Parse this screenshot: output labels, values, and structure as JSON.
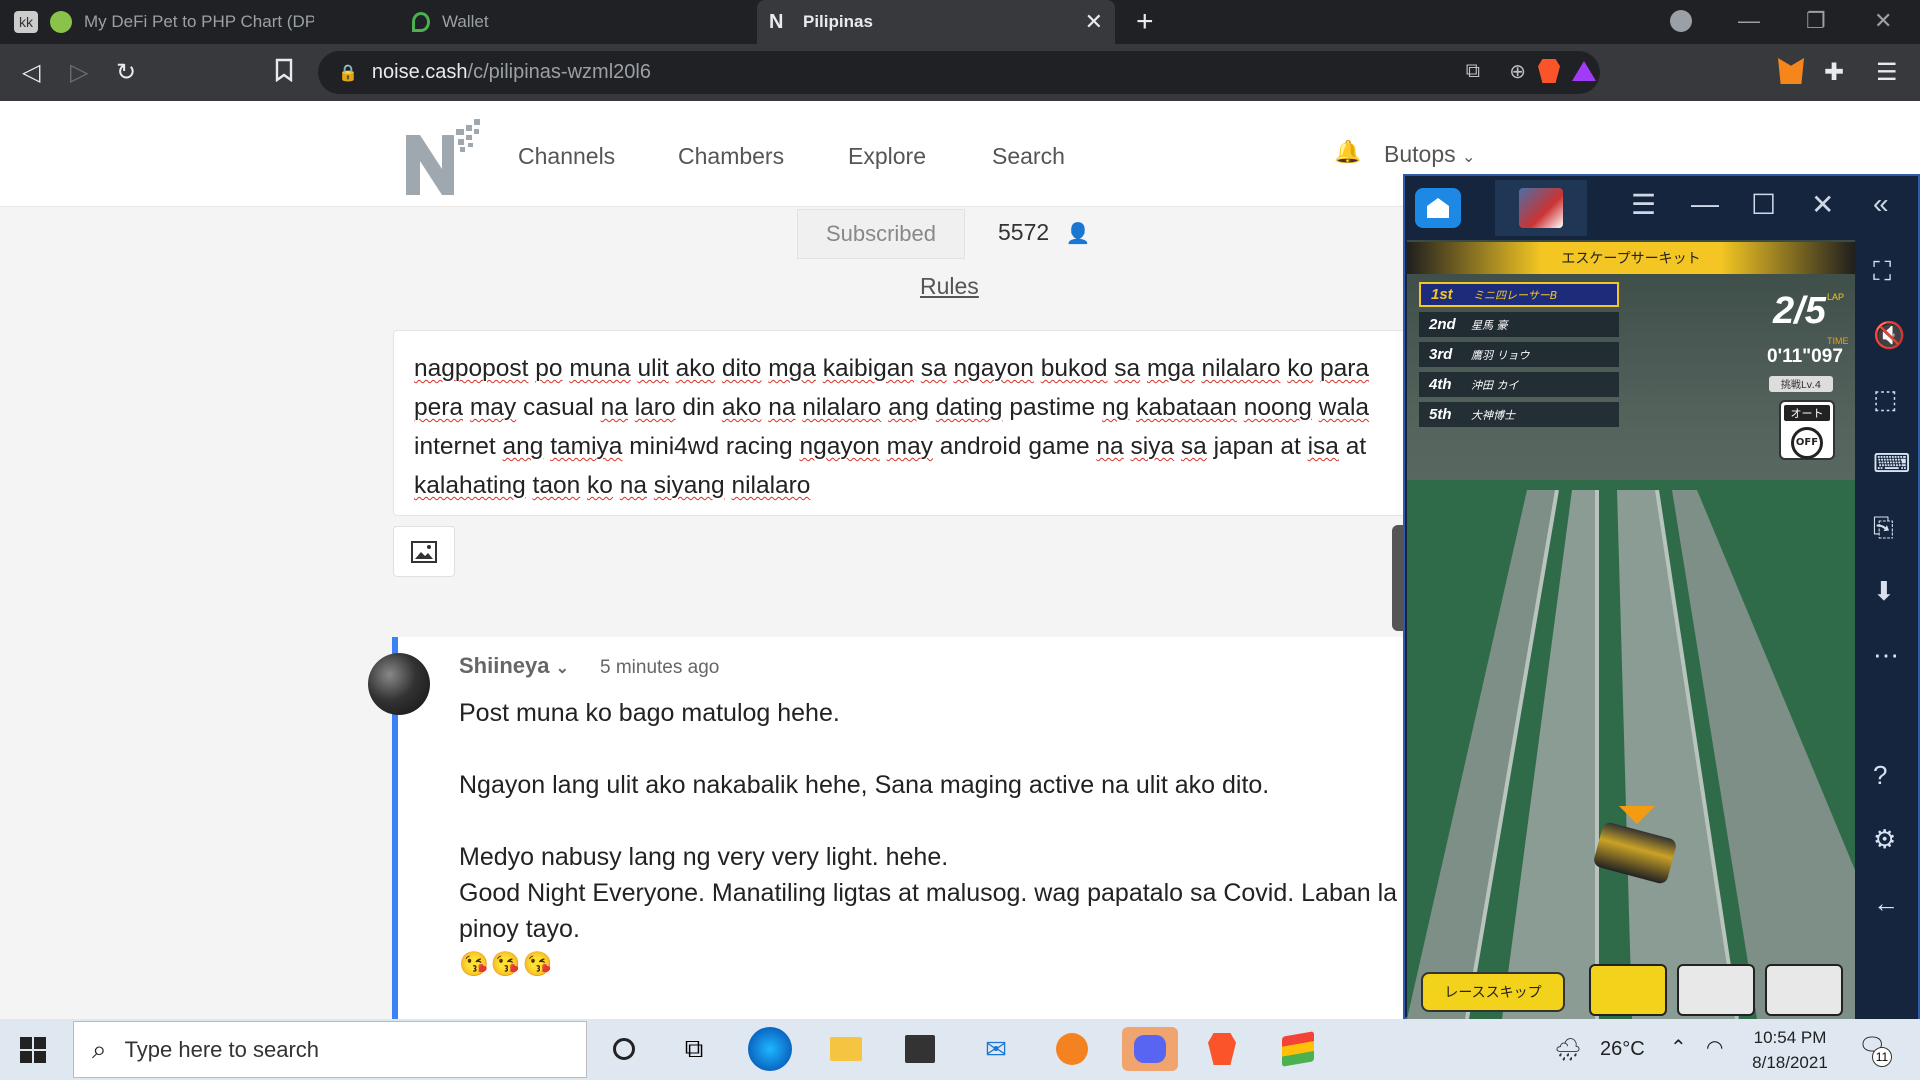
{
  "browser": {
    "tabs": [
      {
        "title": "My DeFi Pet to PHP Chart (DPET/PHP)"
      },
      {
        "title": "Wallet"
      },
      {
        "title": "Pilipinas"
      }
    ],
    "new_tab_glyph": "+",
    "url_host": "noise.cash",
    "url_path": "/c/pilipinas-wzml20l6"
  },
  "site": {
    "nav": [
      "Channels",
      "Chambers",
      "Explore",
      "Search"
    ],
    "user": "Butops"
  },
  "channel": {
    "subscribed_label": "Subscribed",
    "subscriber_count": "5572",
    "rules_label": "Rules"
  },
  "compose": {
    "lines": [
      "nagpopost po muna ulit ako dito mga kaibigan sa ngayon bukod sa mga nilalaro ko para",
      "pera may casual na laro din ako na nilalaro ang dating pastime ng kabataan noong wala",
      "internet ang tamiya mini4wd racing ngayon may android game na siya sa japan at isa at",
      "kalahating taon ko na siyang nilalaro"
    ]
  },
  "post": {
    "author": "Shiineya",
    "time": "5 minutes ago",
    "body": [
      "Post muna ko bago matulog hehe.",
      "",
      "Ngayon lang ulit ako nakabalik hehe, Sana maging active na ulit ako dito.",
      "",
      "Medyo nabusy lang ng very very light. hehe.",
      "Good Night Everyone. Manatiling ligtas at malusog. wag papatalo sa Covid. Laban la",
      "pinoy tayo."
    ],
    "emojis": "😘😘😘"
  },
  "game": {
    "course": "エスケープサーキット",
    "ranks": [
      {
        "pos": "1st",
        "name": "ミニ四レーサーB"
      },
      {
        "pos": "2nd",
        "name": "星馬 豪"
      },
      {
        "pos": "3rd",
        "name": "鷹羽 リョウ"
      },
      {
        "pos": "4th",
        "name": "沖田 カイ"
      },
      {
        "pos": "5th",
        "name": "大神博士"
      }
    ],
    "lap": "2/5",
    "lap_label": "LAP",
    "time_label": "TIME",
    "time": "0'11\"097",
    "challenge": "挑戦Lv.4",
    "auto_label": "オート",
    "auto_state": "OFF",
    "skip_label": "レーススキップ"
  },
  "taskbar": {
    "search_placeholder": "Type here to search",
    "temperature": "26°C",
    "time": "10:54 PM",
    "date": "8/18/2021",
    "notifications": "11"
  },
  "colors": {
    "post_accent": "#3b82f6",
    "bell": "#e53935",
    "browser_dark": "#1f2125",
    "bluestacks": "#14253d"
  }
}
